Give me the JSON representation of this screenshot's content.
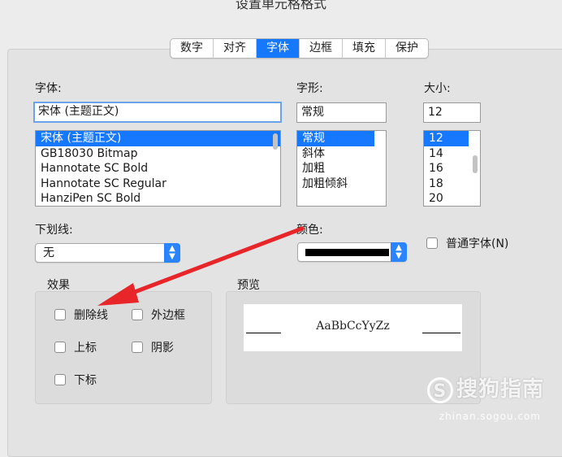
{
  "window_title": "设置单元格格式",
  "tabs": [
    {
      "label": "数字",
      "active": false
    },
    {
      "label": "对齐",
      "active": false
    },
    {
      "label": "字体",
      "active": true
    },
    {
      "label": "边框",
      "active": false
    },
    {
      "label": "填充",
      "active": false
    },
    {
      "label": "保护",
      "active": false
    }
  ],
  "font": {
    "label": "字体:",
    "value": "宋体 (主题正文)",
    "options": [
      "宋体 (主题正文)",
      "GB18030 Bitmap",
      "Hannotate SC Bold",
      "Hannotate SC Regular",
      "HanziPen SC Bold"
    ],
    "selected_index": 0
  },
  "style": {
    "label": "字形:",
    "value": "常规",
    "options": [
      "常规",
      "斜体",
      "加粗",
      "加粗倾斜"
    ],
    "selected_index": 0
  },
  "size": {
    "label": "大小:",
    "value": "12",
    "options": [
      "12",
      "14",
      "16",
      "18",
      "20"
    ],
    "selected_index": 0
  },
  "underline": {
    "label": "下划线:",
    "value": "无"
  },
  "color": {
    "label": "颜色:",
    "swatch": "#000000"
  },
  "normal_font": {
    "label": "普通字体(N)",
    "checked": false
  },
  "effects": {
    "label": "效果",
    "strikethrough": "删除线",
    "outline": "外边框",
    "superscript": "上标",
    "shadow": "阴影",
    "subscript": "下标"
  },
  "preview": {
    "label": "预览",
    "sample": "AaBbCcYyZz"
  },
  "annotation": {
    "arrow_color": "#e8262a"
  },
  "watermark": {
    "brand": "搜狗指南",
    "url": "zhinan.sogou.com"
  },
  "colors": {
    "accent": "#1677ff",
    "select_button": "#2a83ff"
  }
}
